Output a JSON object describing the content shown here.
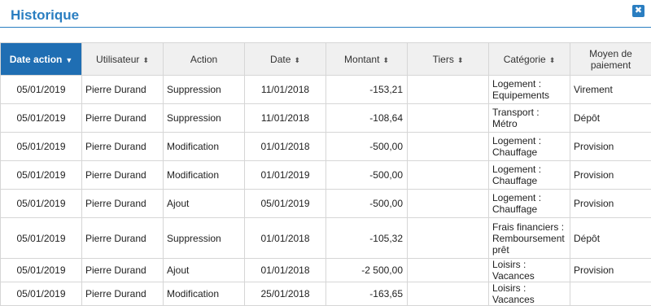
{
  "dialog": {
    "title": "Historique",
    "close_glyph": "✖"
  },
  "columns": [
    {
      "label": "Date action",
      "sort": "▼"
    },
    {
      "label": "Utilisateur",
      "sort": "⬍"
    },
    {
      "label": "Action",
      "sort": ""
    },
    {
      "label": "Date",
      "sort": "⬍"
    },
    {
      "label": "Montant",
      "sort": "⬍"
    },
    {
      "label": "Tiers",
      "sort": "⬍"
    },
    {
      "label": "Catégorie",
      "sort": "⬍"
    },
    {
      "label": "Moyen de paiement",
      "sort": ""
    }
  ],
  "rows": [
    {
      "date_action": "05/01/2019",
      "user": "Pierre Durand",
      "action": "Suppression",
      "date": "11/01/2018",
      "amount": "-153,21",
      "tiers": "",
      "category": "Logement : Equipements",
      "payment": "Virement"
    },
    {
      "date_action": "05/01/2019",
      "user": "Pierre Durand",
      "action": "Suppression",
      "date": "11/01/2018",
      "amount": "-108,64",
      "tiers": "",
      "category": "Transport : Métro",
      "payment": "Dépôt"
    },
    {
      "date_action": "05/01/2019",
      "user": "Pierre Durand",
      "action": "Modification",
      "date": "01/01/2018",
      "amount": "-500,00",
      "tiers": "",
      "category": "Logement : Chauffage",
      "payment": "Provision"
    },
    {
      "date_action": "05/01/2019",
      "user": "Pierre Durand",
      "action": "Modification",
      "date": "01/01/2019",
      "amount": "-500,00",
      "tiers": "",
      "category": "Logement : Chauffage",
      "payment": "Provision"
    },
    {
      "date_action": "05/01/2019",
      "user": "Pierre Durand",
      "action": "Ajout",
      "date": "05/01/2019",
      "amount": "-500,00",
      "tiers": "",
      "category": "Logement : Chauffage",
      "payment": "Provision"
    },
    {
      "date_action": "05/01/2019",
      "user": "Pierre Durand",
      "action": "Suppression",
      "date": "01/01/2018",
      "amount": "-105,32",
      "tiers": "",
      "category": "Frais financiers : Remboursement prêt",
      "payment": "Dépôt"
    },
    {
      "date_action": "05/01/2019",
      "user": "Pierre Durand",
      "action": "Ajout",
      "date": "01/01/2018",
      "amount": "-2 500,00",
      "tiers": "",
      "category": "Loisirs : Vacances",
      "payment": "Provision"
    },
    {
      "date_action": "05/01/2019",
      "user": "Pierre Durand",
      "action": "Modification",
      "date": "25/01/2018",
      "amount": "-163,65",
      "tiers": "",
      "category": "Loisirs : Vacances",
      "payment": ""
    }
  ],
  "colors": {
    "accent": "#2a7ec1",
    "active_header": "#1f6eb3"
  }
}
